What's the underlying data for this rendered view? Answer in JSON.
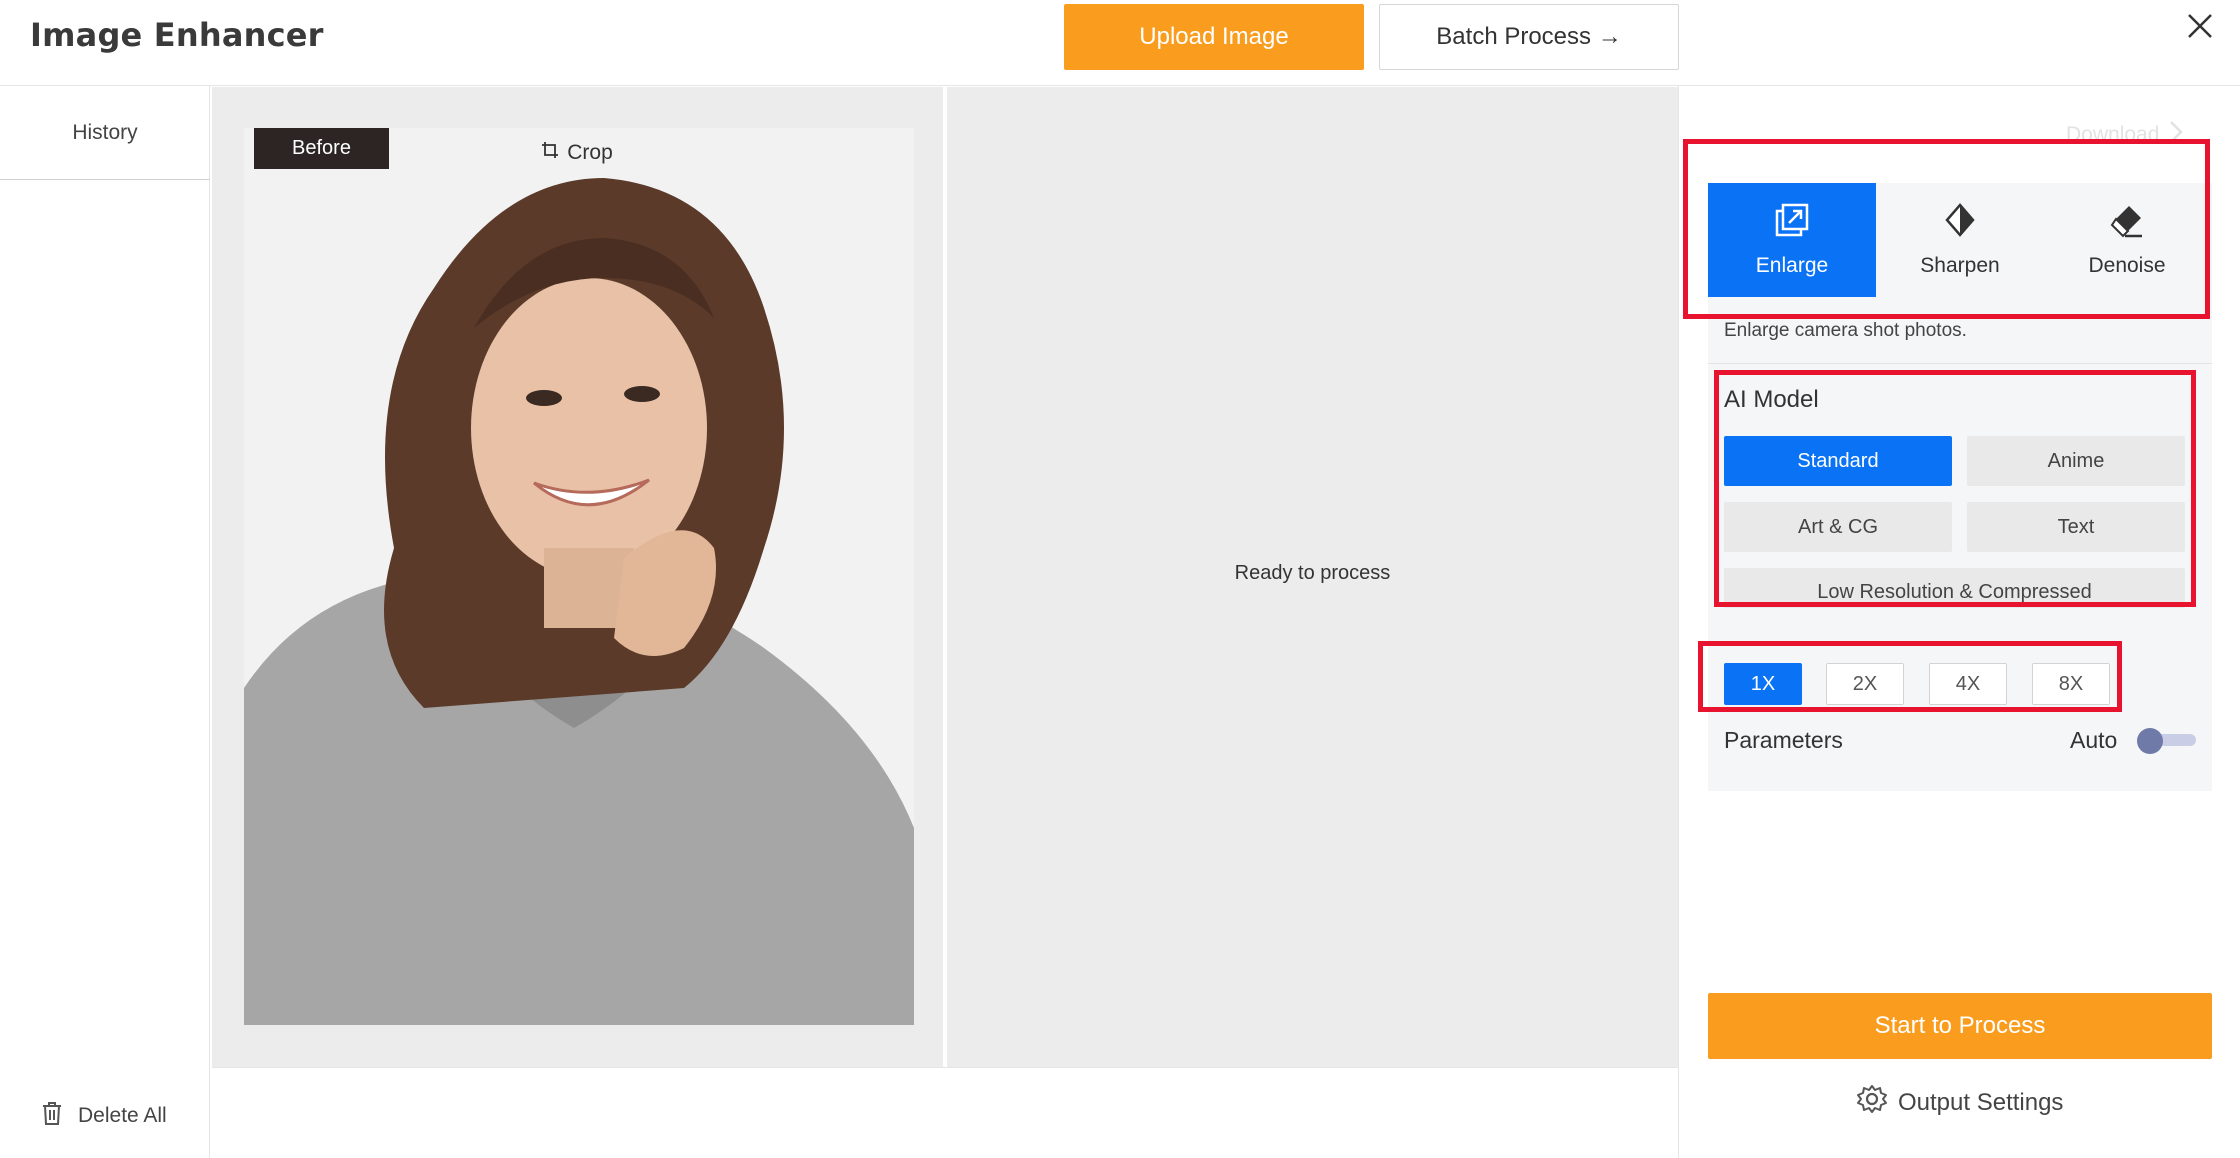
{
  "header": {
    "app_title": "Image Enhancer",
    "upload_label": "Upload Image",
    "batch_label": "Batch Process →"
  },
  "sidebar": {
    "history_label": "History",
    "delete_all_label": "Delete All"
  },
  "canvas": {
    "before_label": "Before",
    "crop_label": "Crop",
    "ready_text": "Ready to process"
  },
  "panel": {
    "download_label": "Download",
    "modes": [
      {
        "label": "Enlarge",
        "icon": "enlarge-icon",
        "active": true
      },
      {
        "label": "Sharpen",
        "icon": "sharpen-icon",
        "active": false
      },
      {
        "label": "Denoise",
        "icon": "denoise-icon",
        "active": false
      }
    ],
    "description": "Enlarge camera shot photos.",
    "ai_model_label": "AI Model",
    "models": [
      {
        "label": "Standard",
        "active": true
      },
      {
        "label": "Anime",
        "active": false
      },
      {
        "label": "Art & CG",
        "active": false
      },
      {
        "label": "Text",
        "active": false
      },
      {
        "label": "Low Resolution & Compressed",
        "active": false
      }
    ],
    "scales": [
      {
        "label": "1X",
        "active": true
      },
      {
        "label": "2X",
        "active": false
      },
      {
        "label": "4X",
        "active": false
      },
      {
        "label": "8X",
        "active": false
      }
    ],
    "parameters_label": "Parameters",
    "auto_label": "Auto",
    "auto_enabled": false,
    "start_label": "Start to Process",
    "output_settings_label": "Output Settings"
  },
  "colors": {
    "accent_blue": "#0a73f5",
    "accent_orange": "#fa9d1e",
    "highlight_red": "#e8132f"
  }
}
